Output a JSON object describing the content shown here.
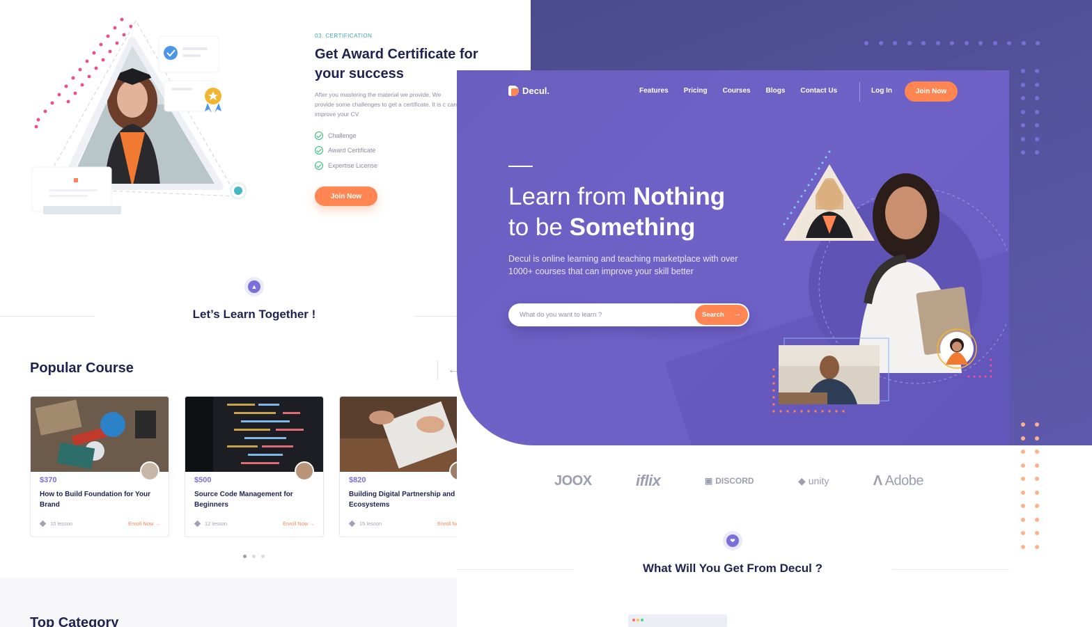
{
  "certification": {
    "eyebrow": "03. CERTIFICATION",
    "title": "Get Award Certificate for your success",
    "description": "After you mastering the material we provide, We provide some challenges to get a certificate. It is c can improve your CV",
    "checklist": [
      "Challenge",
      "Award Certificate",
      "Expertise License"
    ],
    "join_label": "Join Now"
  },
  "learn_together": {
    "title": "Let’s Learn Together !"
  },
  "popular": {
    "title": "Popular Course",
    "prev_arrow": "←",
    "courses": [
      {
        "price": "$370",
        "title": "How to Build Foundation for Your Brand",
        "lessons": "10 lesson",
        "enroll": "Enroll Now →"
      },
      {
        "price": "$500",
        "title": "Source Code Management for Beginners",
        "lessons": "12 lesson",
        "enroll": "Enroll Now →"
      },
      {
        "price": "$820",
        "title": "Building Digital Partnership and Ecosystems",
        "lessons": "15 lesson",
        "enroll": "Enroll Now →"
      }
    ],
    "carousel_active": 1,
    "carousel_total": 3
  },
  "top_category": {
    "title": "Top Category"
  },
  "hero": {
    "logo": "Decul.",
    "nav": [
      "Features",
      "Pricing",
      "Courses",
      "Blogs",
      "Contact Us"
    ],
    "login": "Log In",
    "join": "Join Now",
    "headline_light_1": "Learn from ",
    "headline_bold_1": "Nothing",
    "headline_light_2": "to be ",
    "headline_bold_2": "Something",
    "description": "Decul is online learning and teaching marketplace with over 1000+ courses that can improve your skill better",
    "search_placeholder": "What do you want to learn ?",
    "search_button": "Search",
    "search_arrow": "→"
  },
  "brands": [
    "JOOX",
    "iflix",
    "DISCORD",
    "unity",
    "Adobe"
  ],
  "what_you_get": {
    "title": "What Will You Get From Decul ?"
  },
  "colors": {
    "accent_orange": "#ff8652",
    "purple": "#6a5ec0",
    "navy_text": "#1f2250",
    "teal": "#36a7a7",
    "check_green": "#2dbf6f"
  },
  "icons": [
    "graduation-cap-icon",
    "check-circle-icon",
    "arrow-right-icon",
    "arrow-left-icon",
    "layers-icon",
    "hand-heart-icon"
  ]
}
